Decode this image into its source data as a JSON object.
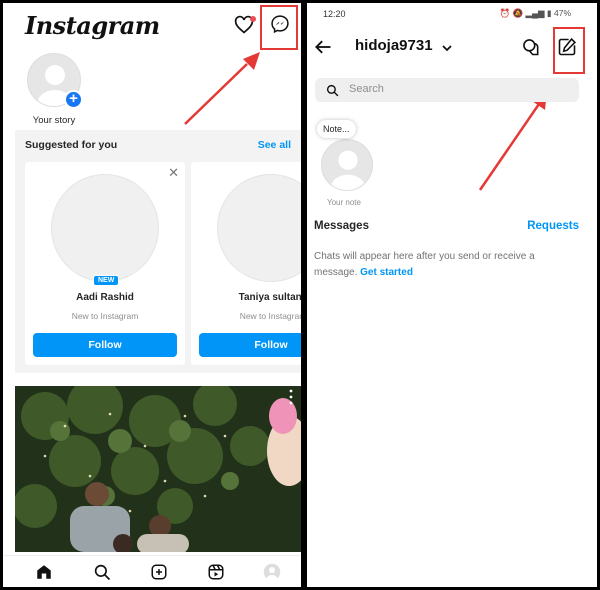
{
  "left_screen": {
    "app_title": "Instagram",
    "story": {
      "label": "Your story"
    },
    "suggested": {
      "title": "Suggested for you",
      "see_all": "See all",
      "cards": [
        {
          "name": "Aadi Rashid",
          "subtitle": "New to Instagram",
          "badge": "NEW",
          "follow_label": "Follow",
          "close": "✕"
        },
        {
          "name": "Taniya sultana",
          "subtitle": "New to Instagram",
          "follow_label": "Follow"
        }
      ]
    },
    "bottom_nav": [
      "home-icon",
      "search-icon",
      "create-icon",
      "reels-icon",
      "profile-icon"
    ]
  },
  "right_screen": {
    "status_bar": {
      "time": "12:20",
      "battery": "47%"
    },
    "header": {
      "username": "hidoja9731"
    },
    "search": {
      "placeholder": "Search"
    },
    "note": {
      "bubble": "Note...",
      "label": "Your note"
    },
    "messages": {
      "title": "Messages",
      "requests": "Requests",
      "empty_text": "Chats will appear here after you send or receive a message.",
      "get_started": "Get started"
    }
  },
  "colors": {
    "accent": "#0095f6",
    "annotation": "#e53935",
    "notification": "#ed4956"
  }
}
